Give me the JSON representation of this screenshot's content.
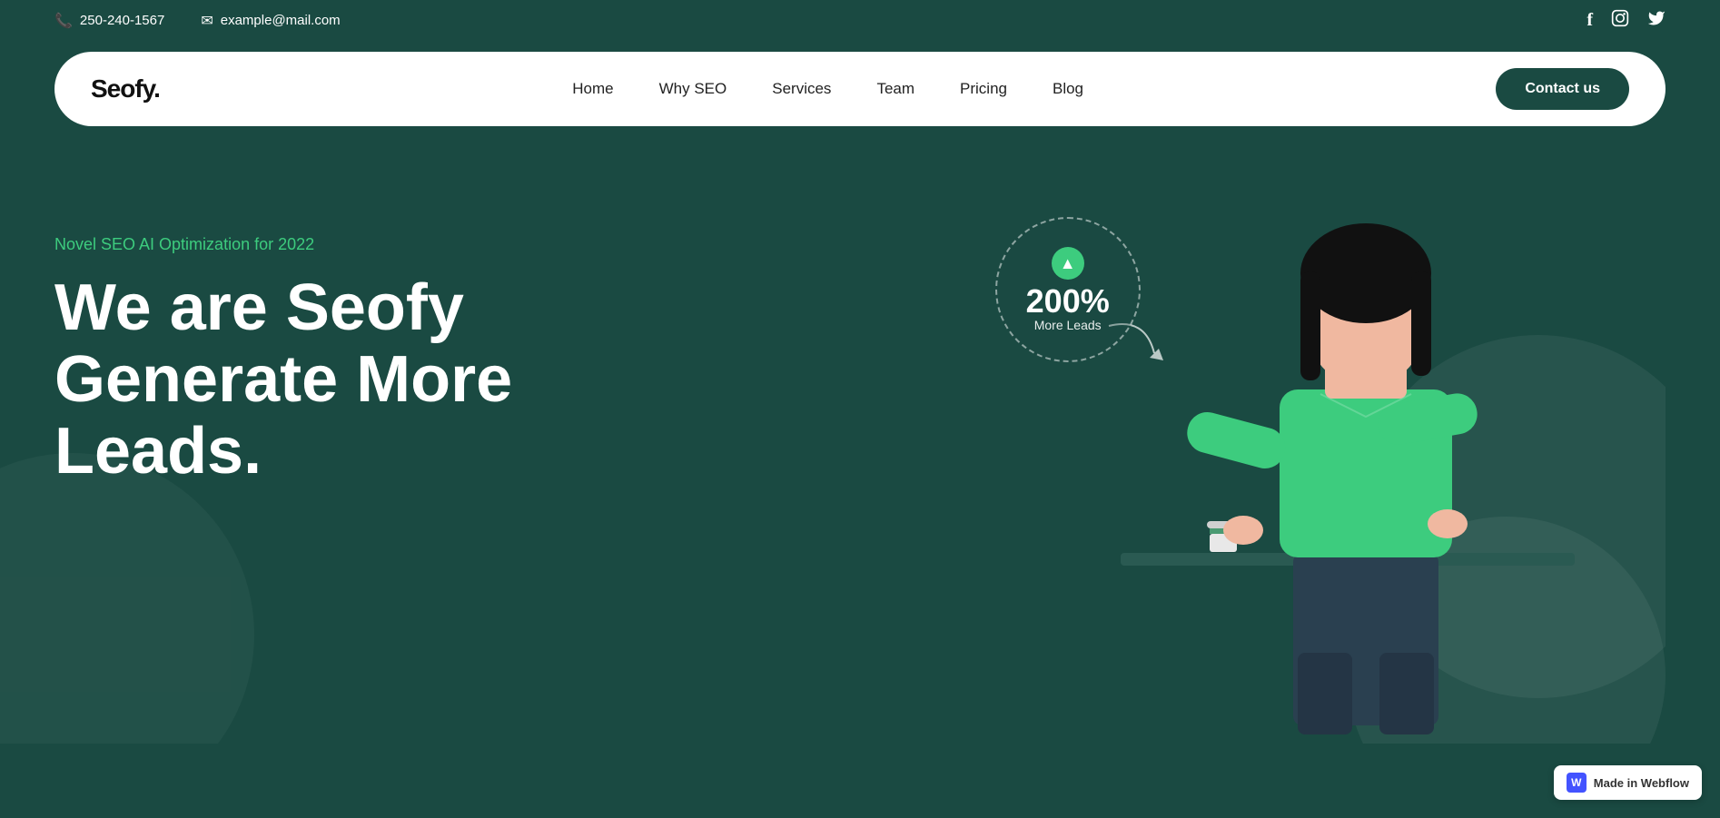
{
  "topbar": {
    "phone": "250-240-1567",
    "email": "example@mail.com",
    "socials": [
      "facebook",
      "instagram",
      "twitter"
    ]
  },
  "nav": {
    "logo": "Seofy.",
    "links": [
      {
        "label": "Home",
        "id": "home"
      },
      {
        "label": "Why SEO",
        "id": "why-seo"
      },
      {
        "label": "Services",
        "id": "services"
      },
      {
        "label": "Team",
        "id": "team"
      },
      {
        "label": "Pricing",
        "id": "pricing"
      },
      {
        "label": "Blog",
        "id": "blog"
      }
    ],
    "cta": "Contact us"
  },
  "hero": {
    "subtitle": "Novel SEO AI Optimization for 2022",
    "title_line1": "We are Seofy",
    "title_line2": "Generate More",
    "title_line3": "Leads.",
    "badge_percent": "200%",
    "badge_label": "More Leads"
  },
  "webflow": {
    "label": "Made in Webflow",
    "w": "W"
  }
}
